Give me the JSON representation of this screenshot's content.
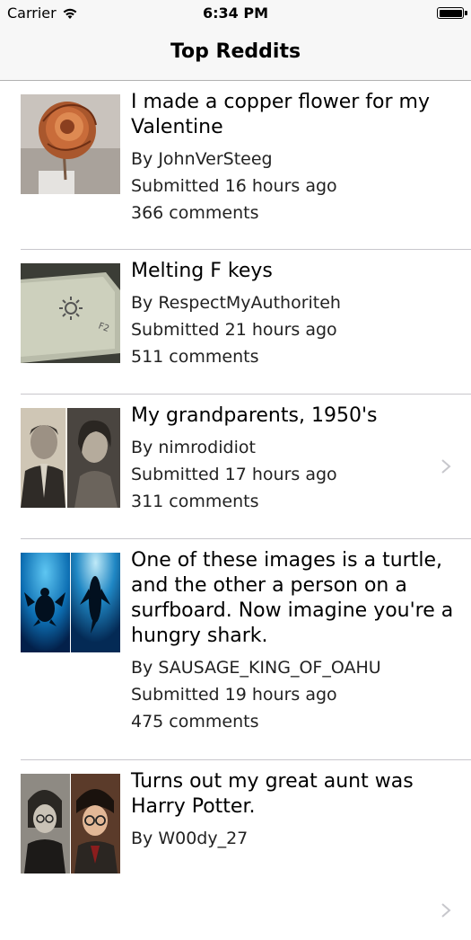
{
  "status_bar": {
    "carrier": "Carrier",
    "time": "6:34 PM",
    "wifi_icon": "wifi-icon",
    "battery_icon": "battery-icon"
  },
  "nav": {
    "title": "Top Reddits"
  },
  "posts": [
    {
      "title": "I made a copper flower for my Valentine",
      "author": "By JohnVerSteeg",
      "submitted": "Submitted 16 hours ago",
      "comments": "366 comments",
      "thumbnail": "copper-rose-thumbnail"
    },
    {
      "title": "Melting F keys",
      "author": "By RespectMyAuthoriteh",
      "submitted": "Submitted 21 hours ago",
      "comments": "511 comments",
      "thumbnail": "keyboard-key-thumbnail"
    },
    {
      "title": "My grandparents, 1950's",
      "author": "By nimrodidiot",
      "submitted": "Submitted 17 hours ago",
      "comments": "311 comments",
      "thumbnail": "grandparents-photo-thumbnail"
    },
    {
      "title": "One of these images is a turtle, and the other a person on a surfboard. Now imagine you're a hungry shark.",
      "author": "By SAUSAGE_KING_OF_OAHU",
      "submitted": "Submitted 19 hours ago",
      "comments": "475 comments",
      "thumbnail": "turtle-surfer-thumbnail"
    },
    {
      "title": "Turns out my great aunt was Harry Potter.",
      "author": "By W00dy_27",
      "submitted": "",
      "comments": "",
      "thumbnail": "great-aunt-harry-potter-thumbnail"
    }
  ],
  "colors": {
    "bar_background": "#f7f7f7",
    "separator": "#c8c7cc",
    "chevron": "#c7c7cc"
  }
}
